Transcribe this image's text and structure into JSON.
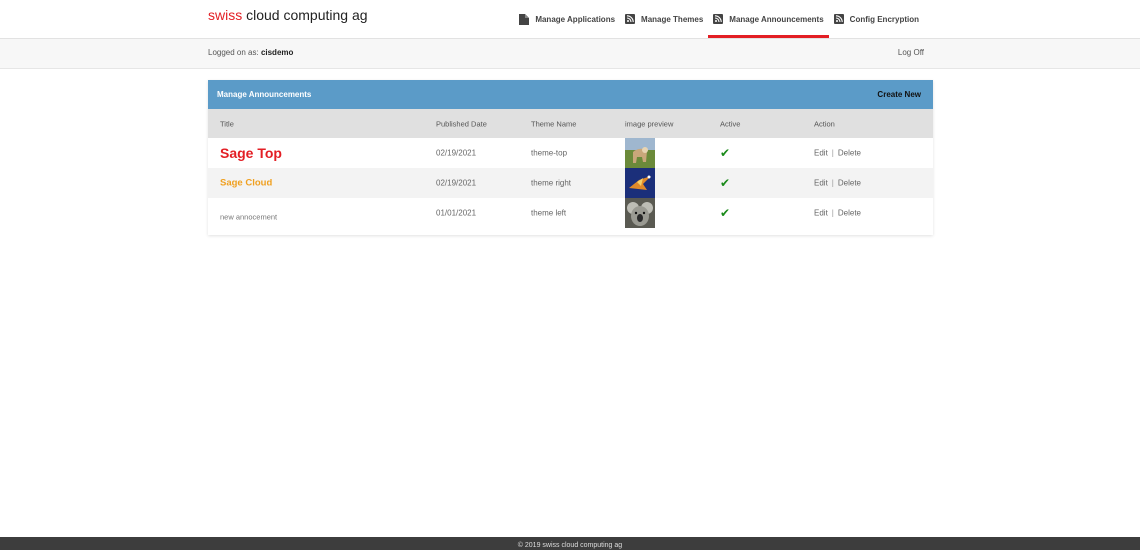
{
  "brand": {
    "red": "swiss",
    "rest": " cloud computing ag"
  },
  "nav": [
    {
      "label": "Manage Applications",
      "icon": "file-icon",
      "active": false
    },
    {
      "label": "Manage Themes",
      "icon": "rss-icon",
      "active": false
    },
    {
      "label": "Manage Announcements",
      "icon": "rss-icon",
      "active": true
    },
    {
      "label": "Config Encryption",
      "icon": "rss-icon",
      "active": false
    }
  ],
  "session": {
    "prefix": "Logged on as: ",
    "user": "cisdemo",
    "logoff": "Log Off"
  },
  "panel": {
    "title": "Manage Announcements",
    "create_new": "Create New",
    "columns": [
      "Title",
      "Published Date",
      "Theme Name",
      "image preview",
      "Active",
      "Action"
    ],
    "rows": [
      {
        "title": "Sage Top",
        "date": "02/19/2021",
        "theme": "theme-top",
        "image": "cow-thumbnail",
        "active": "✔",
        "edit": "Edit",
        "delete": "Delete",
        "title_color": "#e31e24"
      },
      {
        "title": "Sage Cloud",
        "date": "02/19/2021",
        "theme": "theme right",
        "image": "bird-thumbnail",
        "active": "✔",
        "edit": "Edit",
        "delete": "Delete",
        "title_color": "#f0a020"
      },
      {
        "title": "new annocement",
        "date": "01/01/2021",
        "theme": "theme left",
        "image": "koala-thumbnail",
        "active": "✔",
        "edit": "Edit",
        "delete": "Delete",
        "title_color": "#777777"
      }
    ]
  },
  "footer": {
    "text": "© 2019 swiss cloud computing ag"
  },
  "colors": {
    "accent": "#e31e24",
    "panel_header": "#5b9bc8",
    "check": "#1a8a1a",
    "footer": "#3d3d3d"
  }
}
